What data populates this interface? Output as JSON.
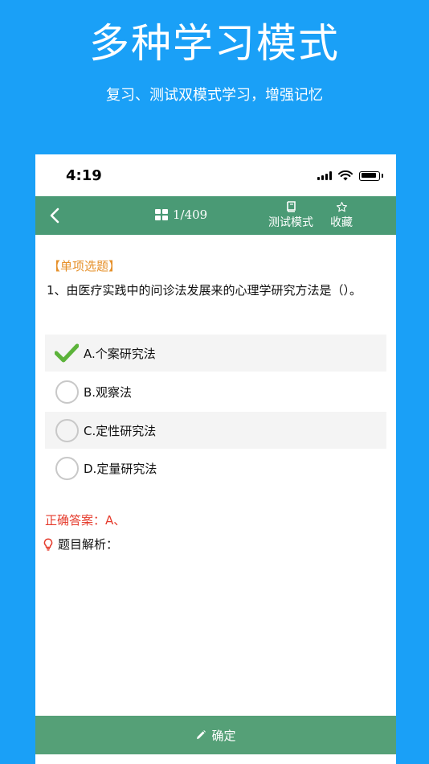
{
  "promo": {
    "title": "多种学习模式",
    "subtitle": "复习、测试双模式学习，增强记忆"
  },
  "status_bar": {
    "time": "4:19"
  },
  "navbar": {
    "page_counter": "1/409",
    "mode_label": "测试模式",
    "favorite_label": "收藏",
    "icons": [
      "chevron-left-icon",
      "grid-icon",
      "book-icon",
      "star-icon"
    ]
  },
  "question": {
    "type": "【单项选题】",
    "text": "1、由医疗实践中的问诊法发展来的心理学研究方法是（）。",
    "options": [
      {
        "label": "A.个案研究法",
        "selected": true
      },
      {
        "label": "B.观察法",
        "selected": false
      },
      {
        "label": "C.定性研究法",
        "selected": false
      },
      {
        "label": "D.定量研究法",
        "selected": false
      }
    ]
  },
  "answer": {
    "correct": "正确答案：A、",
    "analysis_label": "题目解析："
  },
  "footer": {
    "confirm_label": "确定"
  },
  "colors": {
    "background": "#1aa0f7",
    "navbar": "#4a9a75",
    "confirm": "#55a077",
    "question_type": "#e6902a",
    "answer": "#e53b2c",
    "check": "#5cb33a"
  }
}
